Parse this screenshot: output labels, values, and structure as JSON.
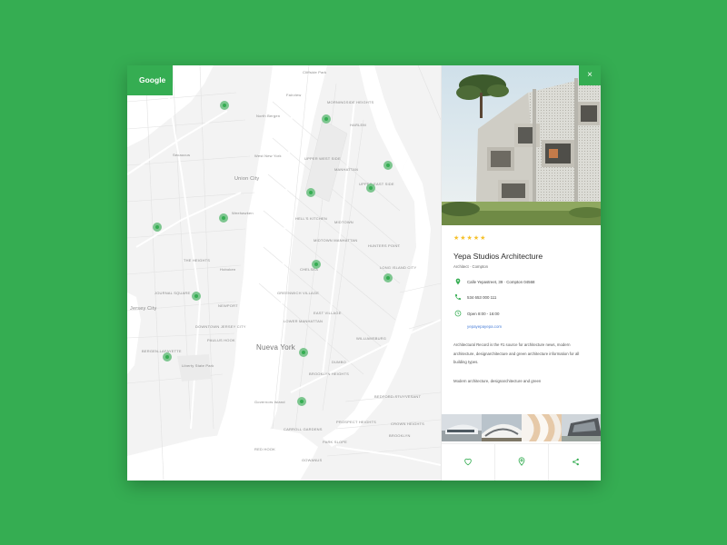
{
  "map": {
    "logo": "Google",
    "labels": {
      "cliffside_park": "Cliffside Park",
      "fairview": "Fairview",
      "north_bergen": "North Bergen",
      "morningside_heights": "MORNINGSIDE HEIGHTS",
      "harlem": "HARLEM",
      "secaucus": "Secaucus",
      "west_new_york": "West New York",
      "upper_west_side": "UPPER WEST SIDE",
      "manhattan": "MANHATTAN",
      "union_city": "Union City",
      "upper_east_side": "UPPER EAST SIDE",
      "weehawken": "Weehawken",
      "hells_kitchen": "HELL'S KITCHEN",
      "midtown": "MIDTOWN",
      "midtown_manhattan": "MIDTOWN MANHATTAN",
      "hunters_point": "HUNTERS POINT",
      "long_island_city": "LONG ISLAND CITY",
      "hoboken": "Hoboken",
      "the_heights": "THE HEIGHTS",
      "chelsea": "CHELSEA",
      "journal_square": "JOURNAL SQUARE",
      "jersey_city": "Jersey City",
      "newport": "NEWPORT",
      "greenwich_village": "GREENWICH VILLAGE",
      "east_village": "EAST VILLAGE",
      "downtown_jersey_city": "DOWNTOWN JERSEY CITY",
      "paulus_hook": "PAULUS HOOK",
      "lower_manhattan": "LOWER MANHATTAN",
      "nueva_york": "Nueva York",
      "bergen_lafayette": "BERGEN-LAFAYETTE",
      "liberty_state_park": "Liberty State Park",
      "williamsburg": "WILLIAMSBURG",
      "brooklyn_heights": "BROOKLYN HEIGHTS",
      "dumbo": "DUMBO",
      "governors_island": "Governors Island",
      "bedford_stuyvesant": "BEDFORD-STUYVESANT",
      "carroll_gardens": "CARROLL GARDENS",
      "park_slope": "PARK SLOPE",
      "crown_heights": "CROWN HEIGHTS",
      "brooklyn": "BROOKLYN",
      "red_hook": "RED HOOK",
      "prospect_heights": "PROSPECT HEIGHTS",
      "gowanus": "GOWANUS"
    }
  },
  "panel": {
    "close_icon": "×",
    "stars": "★★★★★",
    "rating": 5,
    "title": "Yepa Studios Architecture",
    "subtitle": "Architect · Compton",
    "address": "Calle Yepastreet, 39 · Compton 04568",
    "phone": "534 653 000 111",
    "hours": "Open 8:00 - 16:00",
    "website": "yepayepayepa.com",
    "description": "Architectural Record is the #1 source for architecture news, modern architecture, designarchitecture and green architecture information for all building types.",
    "description2": "Modern architecture, designarchitecture and green",
    "accent": "#35ad52",
    "star_color": "#f5c02a",
    "link_color": "#4a7fd8"
  },
  "actions": {
    "favorite": "heart-icon",
    "directions": "location-pin-icon",
    "share": "share-icon"
  }
}
